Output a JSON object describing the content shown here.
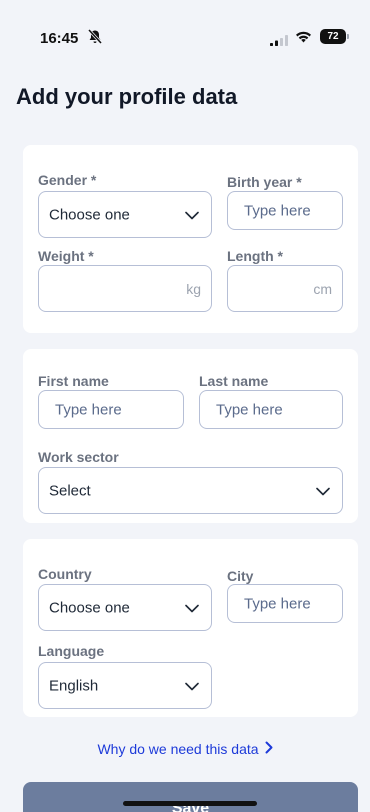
{
  "status_bar": {
    "time": "16:45",
    "battery": "72"
  },
  "page_title": "Add your profile data",
  "card1": {
    "gender": {
      "label": "Gender *",
      "value": "Choose one"
    },
    "birth_year": {
      "label": "Birth year *",
      "placeholder": "Type here"
    },
    "weight": {
      "label": "Weight *",
      "unit": "kg"
    },
    "length": {
      "label": "Length *",
      "unit": "cm"
    }
  },
  "card2": {
    "first_name": {
      "label": "First name",
      "placeholder": "Type here"
    },
    "last_name": {
      "label": "Last name",
      "placeholder": "Type here"
    },
    "work_sector": {
      "label": "Work sector",
      "value": "Select"
    }
  },
  "card3": {
    "country": {
      "label": "Country",
      "value": "Choose one"
    },
    "city": {
      "label": "City",
      "placeholder": "Type here"
    },
    "language": {
      "label": "Language",
      "value": "English"
    }
  },
  "why_link": "Why do we need this data",
  "save_label": "Save",
  "colors": {
    "background": "#f2f4f9",
    "link": "#1d3ad9",
    "button": "#6c7d9e",
    "border": "#b6bfd6"
  }
}
